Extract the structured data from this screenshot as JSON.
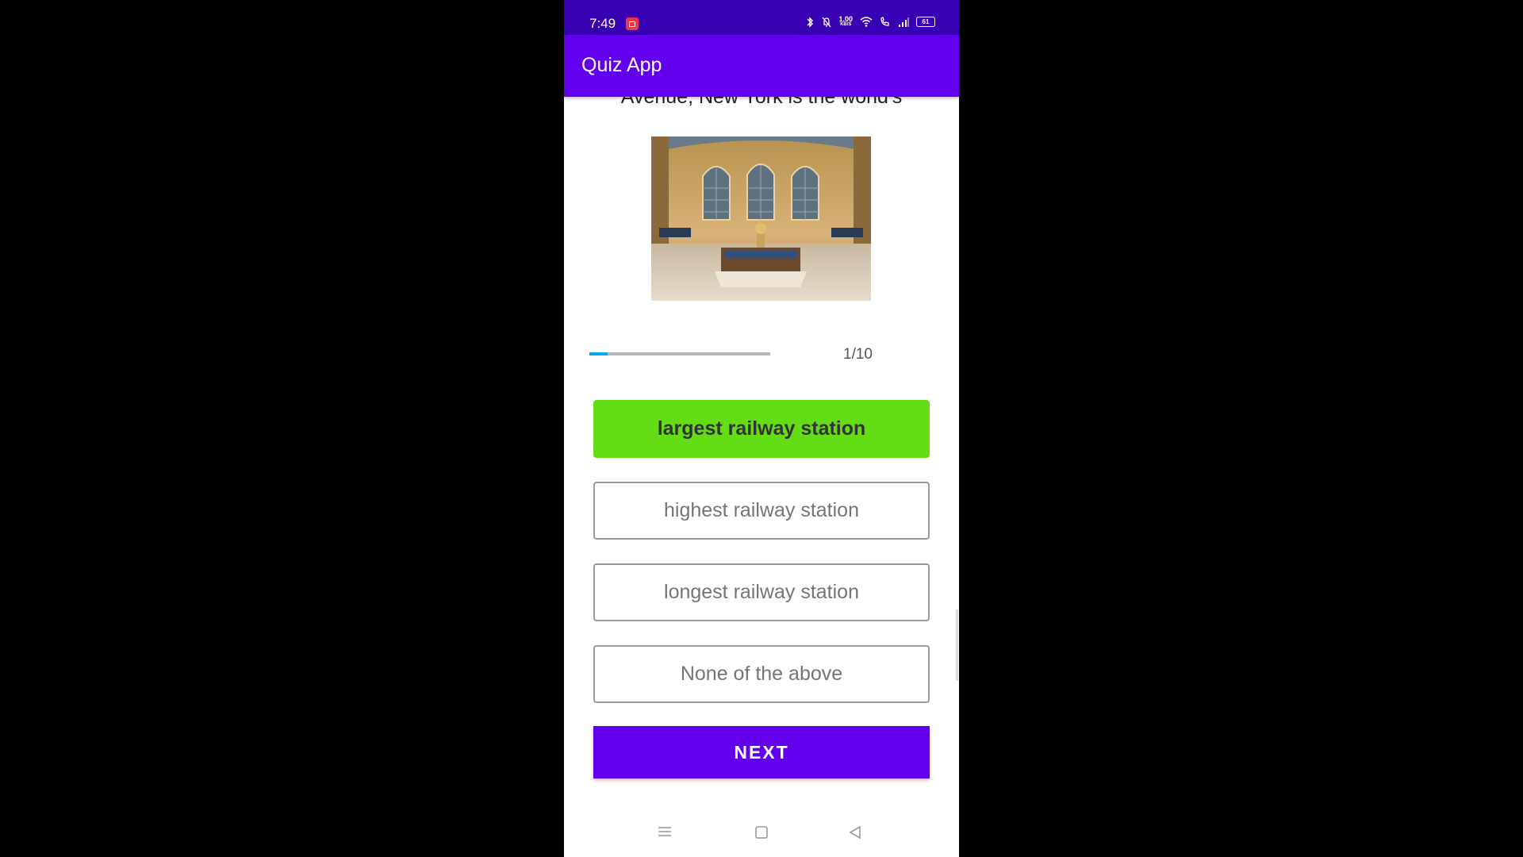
{
  "status_bar": {
    "time": "7:49",
    "data_rate_value": "1.00",
    "data_rate_unit": "KB/S",
    "battery": "61",
    "icons": [
      "screen-record-icon",
      "bluetooth-icon",
      "bell-off-icon",
      "wifi-icon",
      "wifi-call-icon",
      "signal-icon",
      "battery-icon"
    ]
  },
  "app_bar": {
    "title": "Quiz App"
  },
  "question": {
    "text": "Avenue, New York is the world's",
    "image": "grand-central-terminal-photo"
  },
  "progress": {
    "value": 1,
    "max": 10,
    "label": "1/10",
    "color": "#03a9f4"
  },
  "options": [
    {
      "label": "largest railway station",
      "state": "selected"
    },
    {
      "label": "highest railway station",
      "state": "default"
    },
    {
      "label": "longest railway station",
      "state": "default"
    },
    {
      "label": "None of the above",
      "state": "default"
    }
  ],
  "next_button": {
    "label": "NEXT"
  },
  "nav_bar": {
    "icons": [
      "menu-icon",
      "home-icon",
      "back-icon"
    ]
  },
  "colors": {
    "status_bar": "#3700b3",
    "app_bar": "#6200ee",
    "selected_option": "#64dd17",
    "next_button": "#6200ee"
  }
}
